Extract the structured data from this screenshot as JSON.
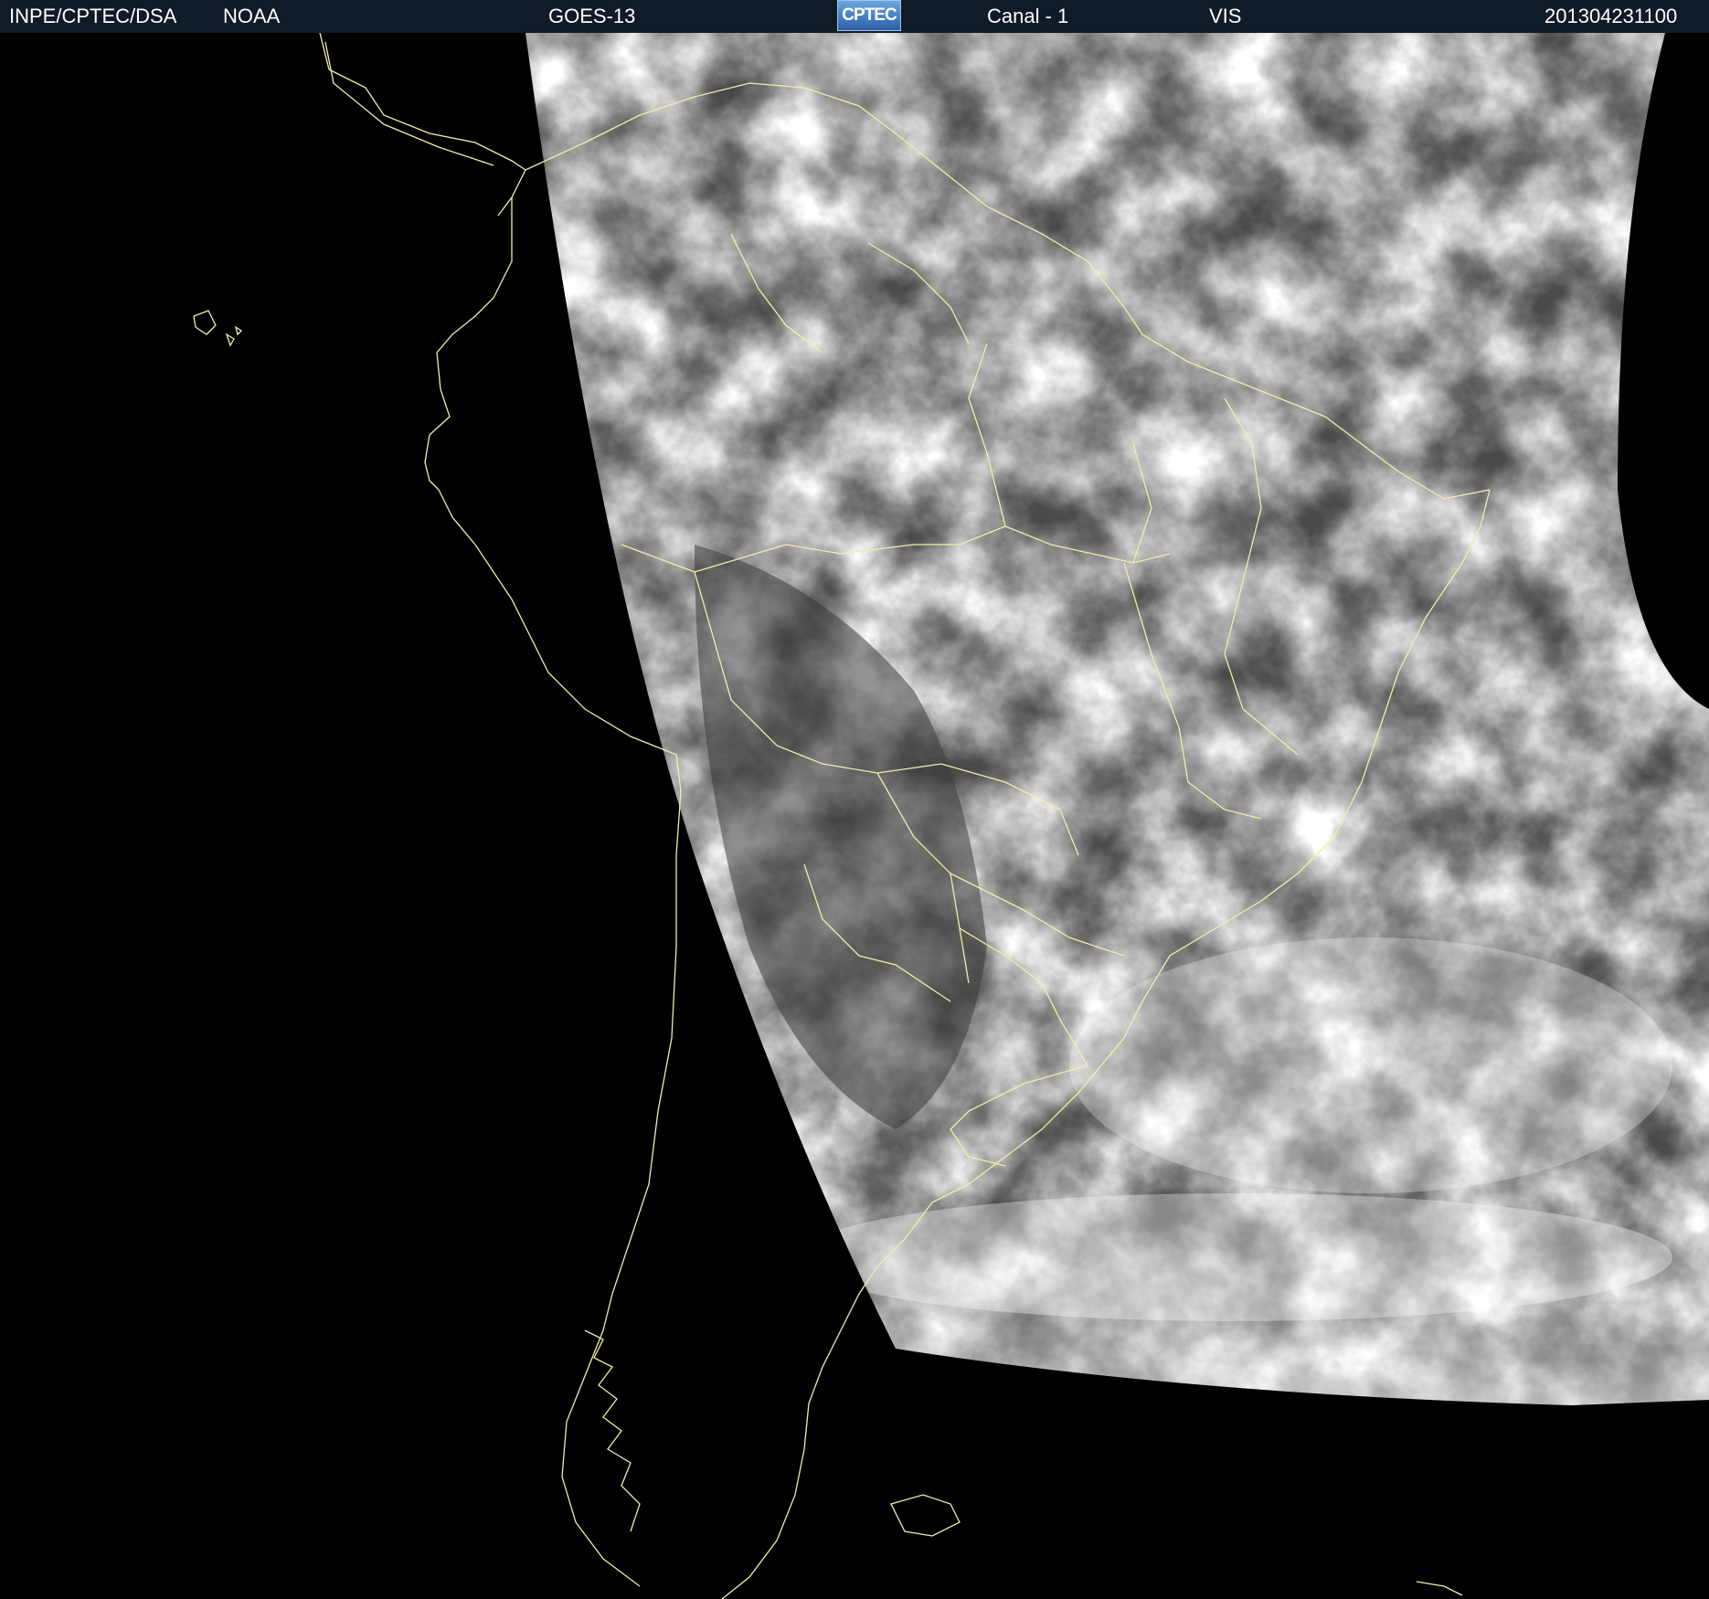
{
  "header": {
    "institution": "INPE/CPTEC/DSA",
    "agency": "NOAA",
    "satellite": "GOES-13",
    "logo_text": "CPTEC",
    "channel": "Canal - 1",
    "band": "VIS",
    "timestamp": "201304231100"
  },
  "colors": {
    "header_bg": "#0f1b27",
    "header_text": "#ffffff",
    "coastline": "#f2eea8",
    "space": "#000000"
  },
  "map": {
    "image_type": "visible satellite imagery",
    "overlay": "coastlines and political boundaries"
  }
}
